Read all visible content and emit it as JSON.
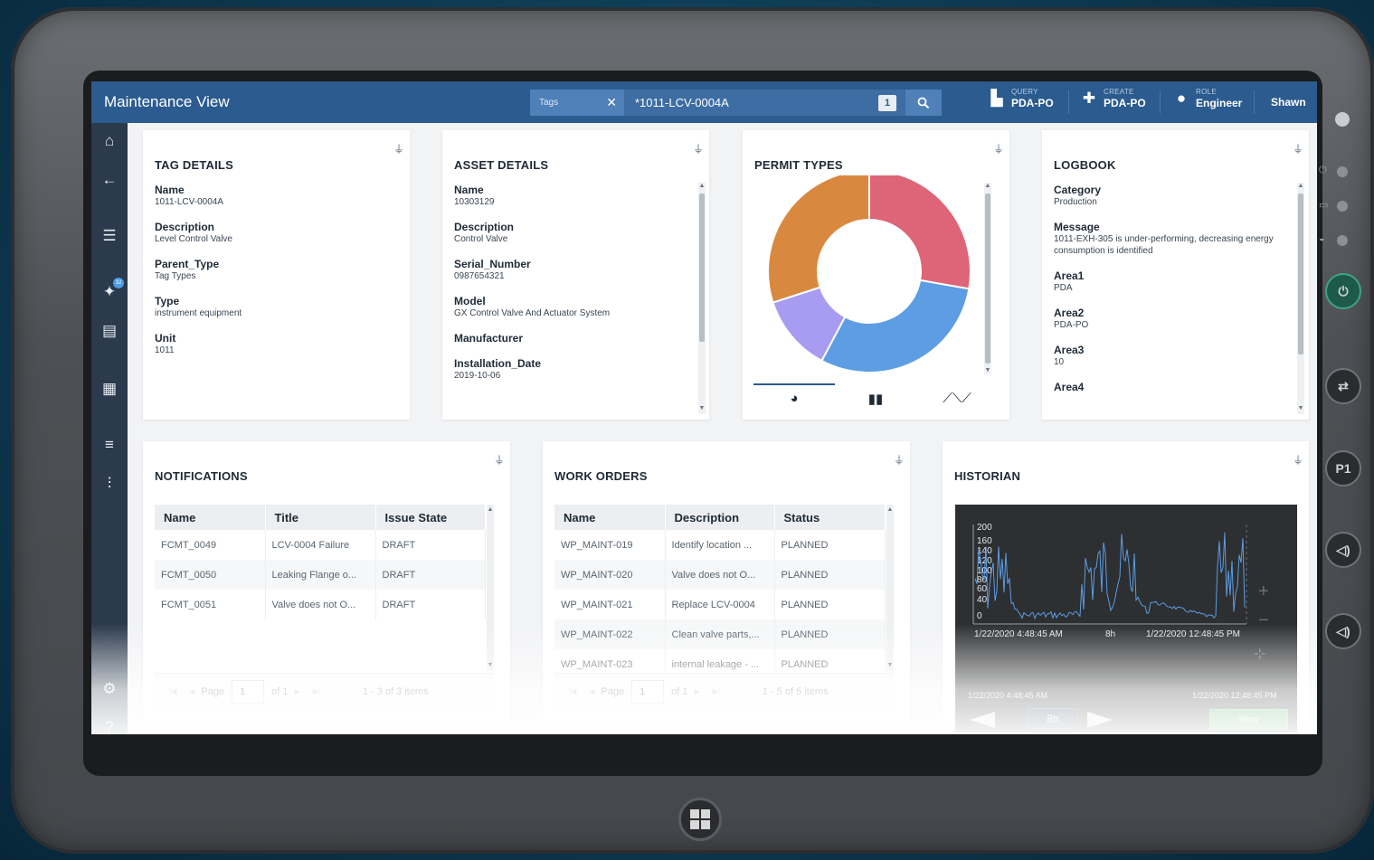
{
  "app": {
    "title": "Maintenance View"
  },
  "search": {
    "chip_label": "Tags",
    "value": "*1011-LCV-0004A",
    "count": "1"
  },
  "header": {
    "query": {
      "small": "QUERY",
      "value": "PDA-PO"
    },
    "create": {
      "small": "CREATE",
      "value": "PDA-PO"
    },
    "role": {
      "small": "ROLE",
      "value": "Engineer"
    },
    "user": "Shawn"
  },
  "nav": {
    "pin_badge": "32"
  },
  "tag_details": {
    "title": "TAG DETAILS",
    "fields": [
      {
        "k": "Name",
        "v": "1011-LCV-0004A"
      },
      {
        "k": "Description",
        "v": "Level Control Valve"
      },
      {
        "k": "Parent_Type",
        "v": "Tag Types"
      },
      {
        "k": "Type",
        "v": "instrument equipment"
      },
      {
        "k": "Unit",
        "v": "1011"
      }
    ]
  },
  "asset_details": {
    "title": "ASSET DETAILS",
    "fields": [
      {
        "k": "Name",
        "v": "10303129"
      },
      {
        "k": "Description",
        "v": "Control Valve"
      },
      {
        "k": "Serial_Number",
        "v": "0987654321"
      },
      {
        "k": "Model",
        "v": "GX Control Valve And Actuator System"
      },
      {
        "k": "Manufacturer",
        "v": ""
      },
      {
        "k": "Installation_Date",
        "v": "2019-10-06"
      }
    ]
  },
  "permit_types": {
    "title": "PERMIT TYPES",
    "colors": {
      "pink": "#de6577",
      "blue": "#5c9de3",
      "purple": "#a79cf2",
      "orange": "#d9893f"
    }
  },
  "logbook": {
    "title": "LOGBOOK",
    "fields": [
      {
        "k": "Category",
        "v": "Production"
      },
      {
        "k": "Message",
        "v": "1011-EXH-305 is under-performing, decreasing energy consumption is identified"
      },
      {
        "k": "Area1",
        "v": "PDA"
      },
      {
        "k": "Area2",
        "v": "PDA-PO"
      },
      {
        "k": "Area3",
        "v": "10"
      },
      {
        "k": "Area4",
        "v": ""
      }
    ]
  },
  "notifications": {
    "title": "NOTIFICATIONS",
    "columns": [
      "Name",
      "Title",
      "Issue State"
    ],
    "rows": [
      [
        "FCMT_0049",
        "LCV-0004 Failure",
        "DRAFT"
      ],
      [
        "FCMT_0050",
        "Leaking Flange o...",
        "DRAFT"
      ],
      [
        "FCMT_0051",
        "Valve does not O...",
        "DRAFT"
      ]
    ],
    "pager": {
      "page_label": "Page",
      "page": "1",
      "of": "of 1",
      "items": "1 - 3 of 3 items"
    }
  },
  "work_orders": {
    "title": "WORK ORDERS",
    "columns": [
      "Name",
      "Description",
      "Status"
    ],
    "rows": [
      [
        "WP_MAINT-019",
        "Identify location ...",
        "PLANNED"
      ],
      [
        "WP_MAINT-020",
        "Valve does not O...",
        "PLANNED"
      ],
      [
        "WP_MAINT-021",
        "Replace LCV-0004",
        "PLANNED"
      ],
      [
        "WP_MAINT-022",
        "Clean valve parts,...",
        "PLANNED"
      ],
      [
        "WP_MAINT-023",
        "internal leakage - ...",
        "PLANNED"
      ]
    ],
    "pager": {
      "page_label": "Page",
      "page": "1",
      "of": "of 1",
      "items": "1 - 5 of 5 items"
    }
  },
  "historian": {
    "title": "HISTORIAN",
    "y_ticks": [
      "200",
      "160",
      "140",
      "120",
      "100",
      "80",
      "60",
      "40",
      "0"
    ],
    "start": "1/22/2020 4:48:45 AM",
    "end": "1/22/2020 12:48:45 PM",
    "span": "8h",
    "nav_start": "1/22/2020 4:48:45 AM",
    "nav_end": "1/22/2020 12:48:45 PM",
    "range": "8h",
    "now_label": "Now"
  }
}
